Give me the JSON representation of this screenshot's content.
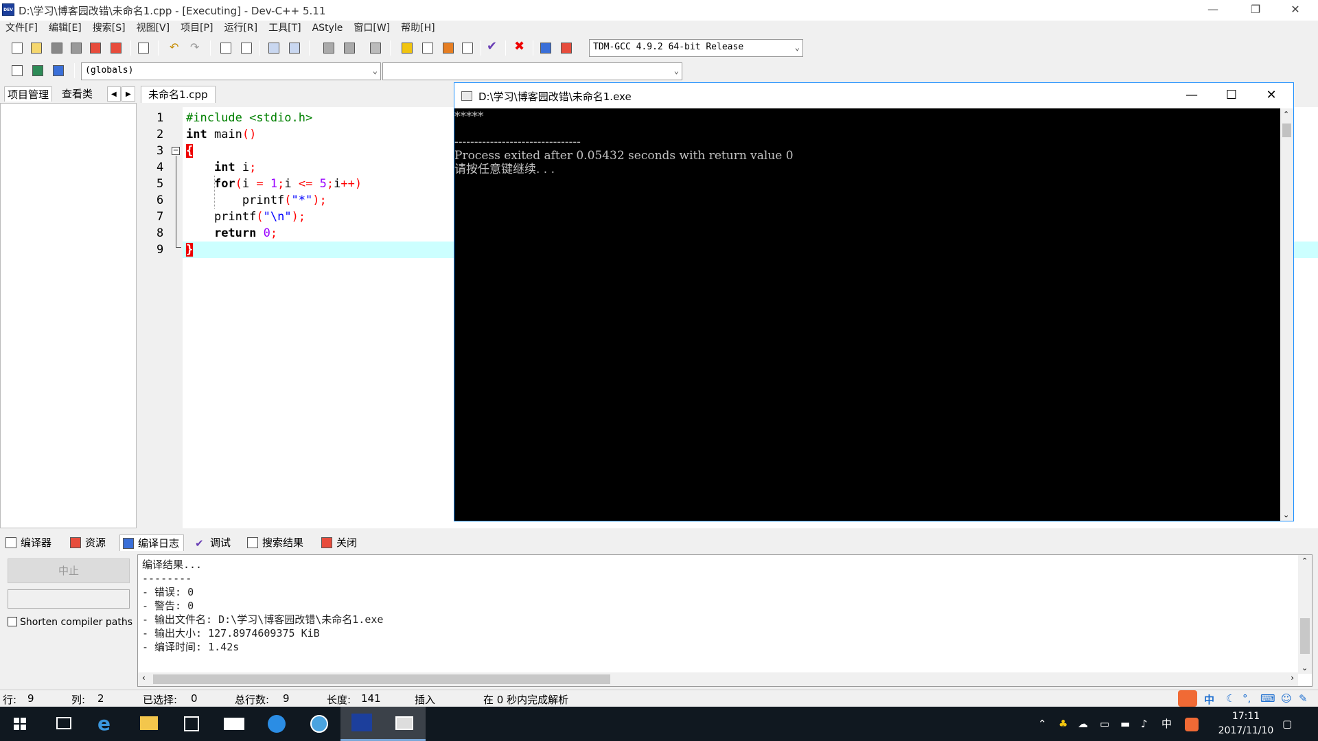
{
  "window": {
    "title": "D:\\学习\\博客园改错\\未命名1.cpp - [Executing] - Dev-C++ 5.11",
    "app_icon_text": "DEV"
  },
  "menu": [
    "文件[F]",
    "编辑[E]",
    "搜索[S]",
    "视图[V]",
    "项目[P]",
    "运行[R]",
    "工具[T]",
    "AStyle",
    "窗口[W]",
    "帮助[H]"
  ],
  "toolbar": {
    "compiler_select": "TDM-GCC 4.9.2 64-bit Release",
    "scope_select": "(globals)",
    "function_select": ""
  },
  "left_panel": {
    "tabs": [
      "项目管理",
      "查看类"
    ],
    "nav_prev": "◀",
    "nav_next": "▶"
  },
  "editor": {
    "file_tab": "未命名1.cpp",
    "line_numbers": [
      "1",
      "2",
      "3",
      "4",
      "5",
      "6",
      "7",
      "8",
      "9"
    ],
    "current_line": 9
  },
  "console": {
    "title": "D:\\学习\\博客园改错\\未命名1.exe",
    "lines": [
      "*****",
      "--------------------------------",
      "Process exited after 0.05432 seconds with return value 0",
      "请按任意键继续. . ."
    ]
  },
  "bottom_tabs": [
    "编译器",
    "资源",
    "编译日志",
    "调试",
    "搜索结果",
    "关闭"
  ],
  "bottom_panel": {
    "stop_button": "中止",
    "shorten_checkbox": "Shorten compiler paths",
    "log": [
      "编译结果...",
      "--------",
      "- 错误: 0",
      "- 警告: 0",
      "- 输出文件名: D:\\学习\\博客园改错\\未命名1.exe",
      "- 输出大小: 127.8974609375 KiB",
      "- 编译时间: 1.42s"
    ]
  },
  "status": {
    "row_label": "行:",
    "row_value": "9",
    "col_label": "列:",
    "col_value": "2",
    "sel_label": "已选择:",
    "sel_value": "0",
    "total_label": "总行数:",
    "total_value": "9",
    "len_label": "长度:",
    "len_value": "141",
    "mode": "插入",
    "parse": "在 0 秒内完成解析"
  },
  "taskbar": {
    "ime": "中",
    "time": "17:11",
    "date": "2017/11/10",
    "tray_ime": "中"
  },
  "colors": {
    "keyword": "#000000",
    "preprocessor": "#008000",
    "symbol": "#ff0000",
    "string": "#0000ff",
    "number": "#9900ff",
    "current_line_bg": "#ccffff",
    "console_bg": "#000000",
    "console_fg": "#c0c0c0"
  }
}
